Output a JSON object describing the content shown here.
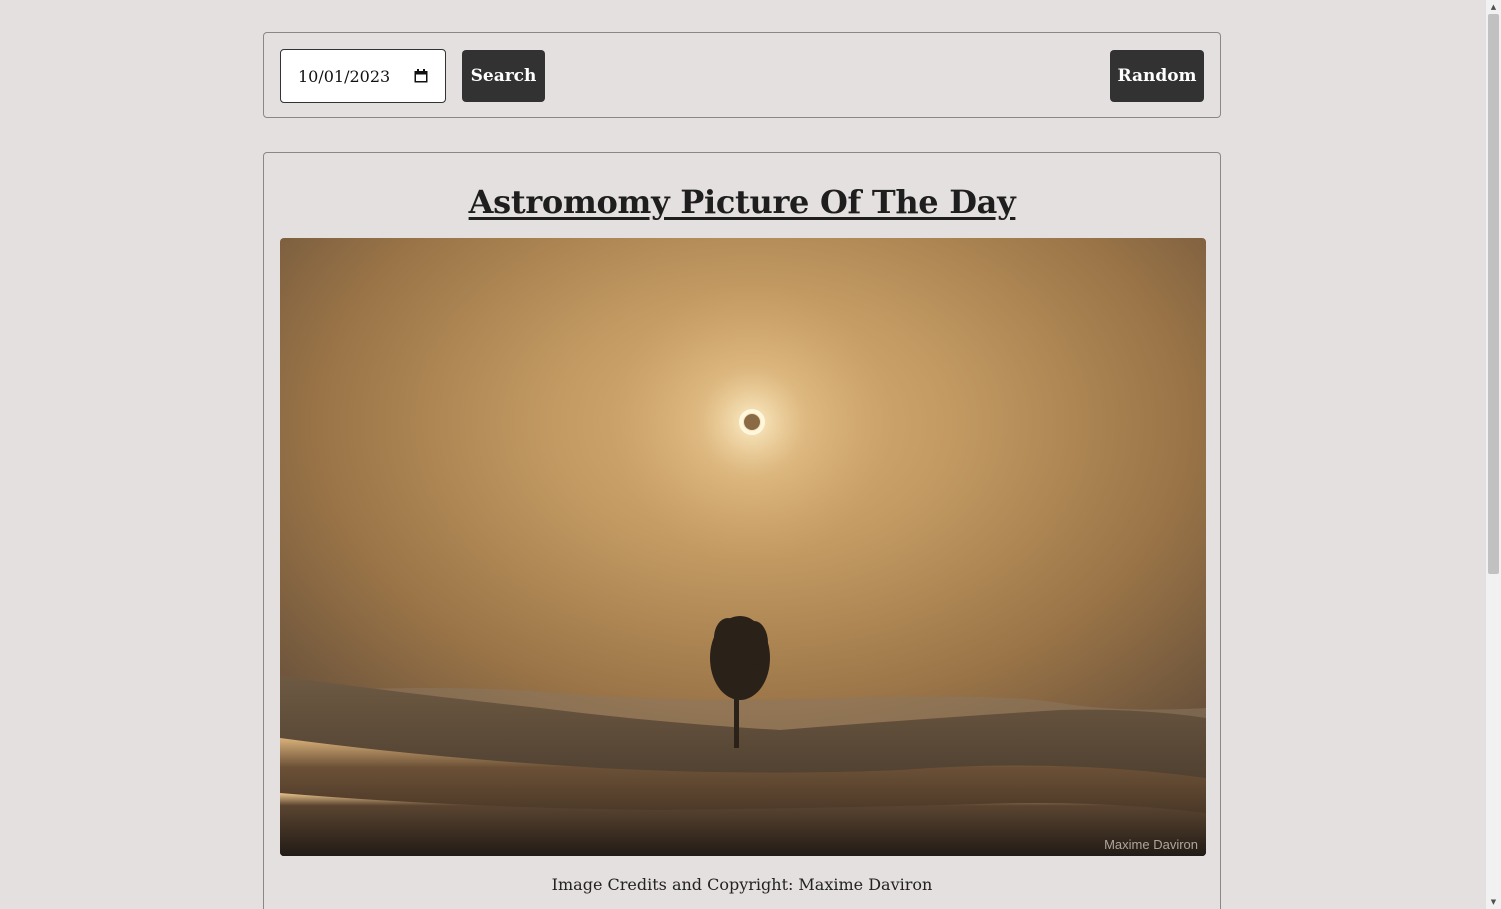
{
  "toolbar": {
    "date_value": "10/01/2023",
    "search_label": "Search",
    "random_label": "Random"
  },
  "card": {
    "title": "Astromomy Picture Of The Day",
    "image_watermark": "Maxime Daviron",
    "credit_prefix": "Image Credits and Copyright:",
    "credit_name": "Maxime Daviron"
  },
  "icons": {
    "calendar": "calendar-icon",
    "scroll_up": "chevron-up-icon",
    "scroll_down": "chevron-down-icon"
  },
  "colors": {
    "background": "#e4e0df",
    "button": "#323232",
    "border": "#8a8887"
  }
}
